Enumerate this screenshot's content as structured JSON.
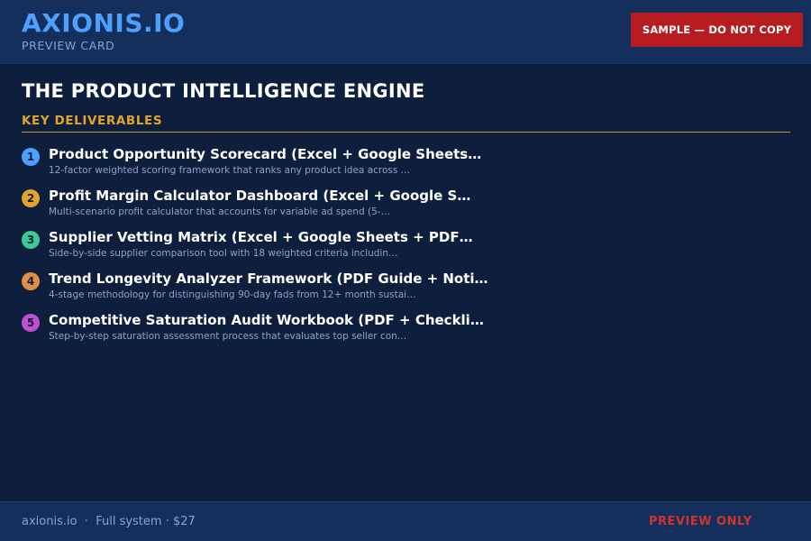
{
  "header": {
    "brand": "AXIONIS.IO",
    "subtitle": "PREVIEW CARD",
    "badge": "SAMPLE — DO NOT COPY"
  },
  "main": {
    "title": "THE PRODUCT INTELLIGENCE ENGINE",
    "section_label": "KEY DELIVERABLES",
    "items": [
      {
        "number": "1",
        "color": "#4da0ff",
        "title": "Product Opportunity Scorecard (Excel + Google Sheets…",
        "description": "12-factor weighted scoring framework that ranks any product idea across …"
      },
      {
        "number": "2",
        "color": "#e0a52a",
        "title": "Profit Margin Calculator Dashboard (Excel + Google S…",
        "description": "Multi-scenario profit calculator that accounts for variable ad spend (5-…"
      },
      {
        "number": "3",
        "color": "#3fc79a",
        "title": "Supplier Vetting Matrix (Excel + Google Sheets + PDF…",
        "description": "Side-by-side supplier comparison tool with 18 weighted criteria includin…"
      },
      {
        "number": "4",
        "color": "#e38e45",
        "title": "Trend Longevity Analyzer Framework (PDF Guide + Noti…",
        "description": "4-stage methodology for distinguishing 90-day fads from 12+ month sustai…"
      },
      {
        "number": "5",
        "color": "#c04fd1",
        "title": "Competitive Saturation Audit Workbook (PDF + Checkli…",
        "description": "Step-by-step saturation assessment process that evaluates top seller con…"
      }
    ]
  },
  "footer": {
    "left": "axionis.io  ·  Full system · $27",
    "right": "PREVIEW ONLY"
  }
}
